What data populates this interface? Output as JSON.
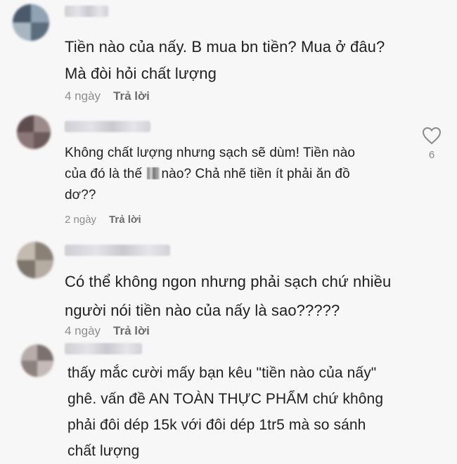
{
  "comments": [
    {
      "lines": [
        "Tiền nào của nấy. B mua bn tiền? Mua ở đâu?",
        "Mà đòi hỏi chất lượng"
      ],
      "time": "4 ngày",
      "reply": "Trả lời"
    },
    {
      "line1": "Không chất lượng nhưng sạch sẽ dùm! Tiền nào",
      "line2_pre": "của đó là thế ",
      "line2_post": "nào? Chả nhẽ tiền ít phải ăn đồ",
      "line3": "dơ??",
      "time": "2 ngày",
      "reply": "Trả lời",
      "likes": "6"
    },
    {
      "lines": [
        "Có thể không ngon nhưng phải sạch chứ nhiều",
        "người nói tiền nào của nấy là sao?????"
      ],
      "time": "4 ngày",
      "reply": "Trả lời"
    },
    {
      "lines": [
        "thấy mắc cười mấy bạn kêu \"tiền nào của nấy\"",
        "ghê. vấn đề AN TOÀN THỰC PHẨM chứ không",
        "phải đôi dép 15k với đôi dép 1tr5 mà so sánh",
        "chất lượng"
      ]
    }
  ],
  "icons": {
    "like": "heart-outline-icon"
  },
  "colors": {
    "background": "#f7f7f7",
    "text": "#1f1f1f",
    "meta": "#8d8d8d"
  }
}
